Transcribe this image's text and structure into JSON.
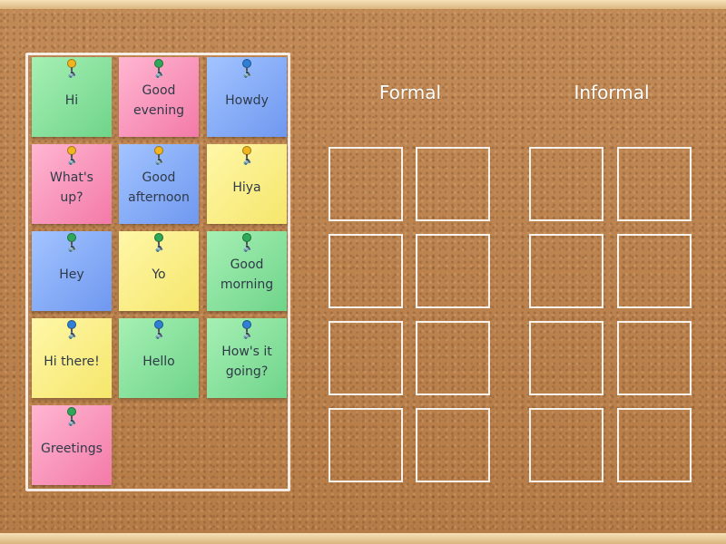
{
  "columns": {
    "formal": "Formal",
    "informal": "Informal"
  },
  "cards": [
    {
      "label": "Hi",
      "color": "green",
      "pin": "yellow"
    },
    {
      "label": "Good\nevening",
      "color": "pink",
      "pin": "green"
    },
    {
      "label": "Howdy",
      "color": "blue",
      "pin": "blue"
    },
    {
      "label": "What's\nup?",
      "color": "pink",
      "pin": "yellow"
    },
    {
      "label": "Good\nafternoon",
      "color": "blue",
      "pin": "yellow"
    },
    {
      "label": "Hiya",
      "color": "yellow",
      "pin": "yellow"
    },
    {
      "label": "Hey",
      "color": "blue",
      "pin": "green"
    },
    {
      "label": "Yo",
      "color": "yellow",
      "pin": "green"
    },
    {
      "label": "Good\nmorning",
      "color": "green",
      "pin": "green"
    },
    {
      "label": "Hi there!",
      "color": "yellow",
      "pin": "blue"
    },
    {
      "label": "Hello",
      "color": "green",
      "pin": "blue"
    },
    {
      "label": "How's it\ngoing?",
      "color": "green",
      "pin": "blue"
    },
    {
      "label": "Greetings",
      "color": "pink",
      "pin": "green"
    }
  ],
  "pin_colors": {
    "yellow": "#f2b51d",
    "green": "#2fa85a",
    "blue": "#2f7fd6"
  }
}
